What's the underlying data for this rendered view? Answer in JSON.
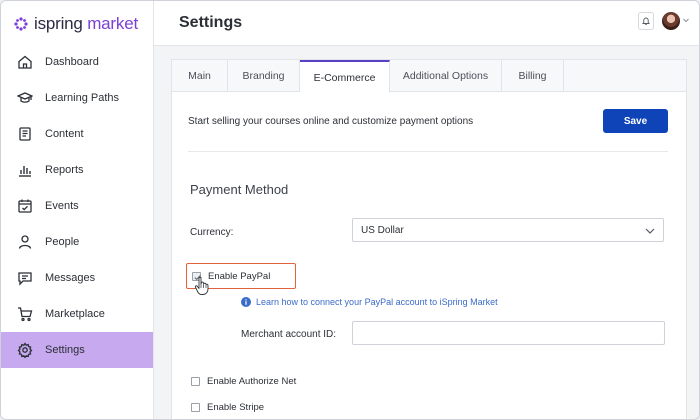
{
  "brand": {
    "name_part1": "ispring",
    "name_part2": " market",
    "accent_color": "#7a3fd6"
  },
  "sidebar": {
    "items": [
      {
        "label": "Dashboard",
        "icon": "home-icon"
      },
      {
        "label": "Learning Paths",
        "icon": "graduation-cap-icon"
      },
      {
        "label": "Content",
        "icon": "document-icon"
      },
      {
        "label": "Reports",
        "icon": "bar-chart-icon"
      },
      {
        "label": "Events",
        "icon": "calendar-icon"
      },
      {
        "label": "People",
        "icon": "person-icon"
      },
      {
        "label": "Messages",
        "icon": "message-icon"
      },
      {
        "label": "Marketplace",
        "icon": "cart-icon"
      },
      {
        "label": "Settings",
        "icon": "gear-icon",
        "active": true
      }
    ],
    "active_color": "#c6a9ee"
  },
  "header": {
    "title": "Settings"
  },
  "tabs": [
    {
      "label": "Main"
    },
    {
      "label": "Branding"
    },
    {
      "label": "E-Commerce",
      "active": true
    },
    {
      "label": "Additional Options"
    },
    {
      "label": "Billing"
    }
  ],
  "ecommerce": {
    "intro": "Start selling your courses online and customize payment options",
    "save_label": "Save",
    "section_title": "Payment Method",
    "currency_label": "Currency:",
    "currency_value": "US Dollar",
    "paypal_label": "Enable PayPal",
    "paypal_checked": true,
    "paypal_help_link": "Learn how to connect your PayPal account to iSpring Market",
    "merchant_label": "Merchant account ID:",
    "merchant_value": "",
    "authorize_label": "Enable Authorize Net",
    "stripe_label": "Enable Stripe",
    "save_color": "#0e44b8"
  }
}
